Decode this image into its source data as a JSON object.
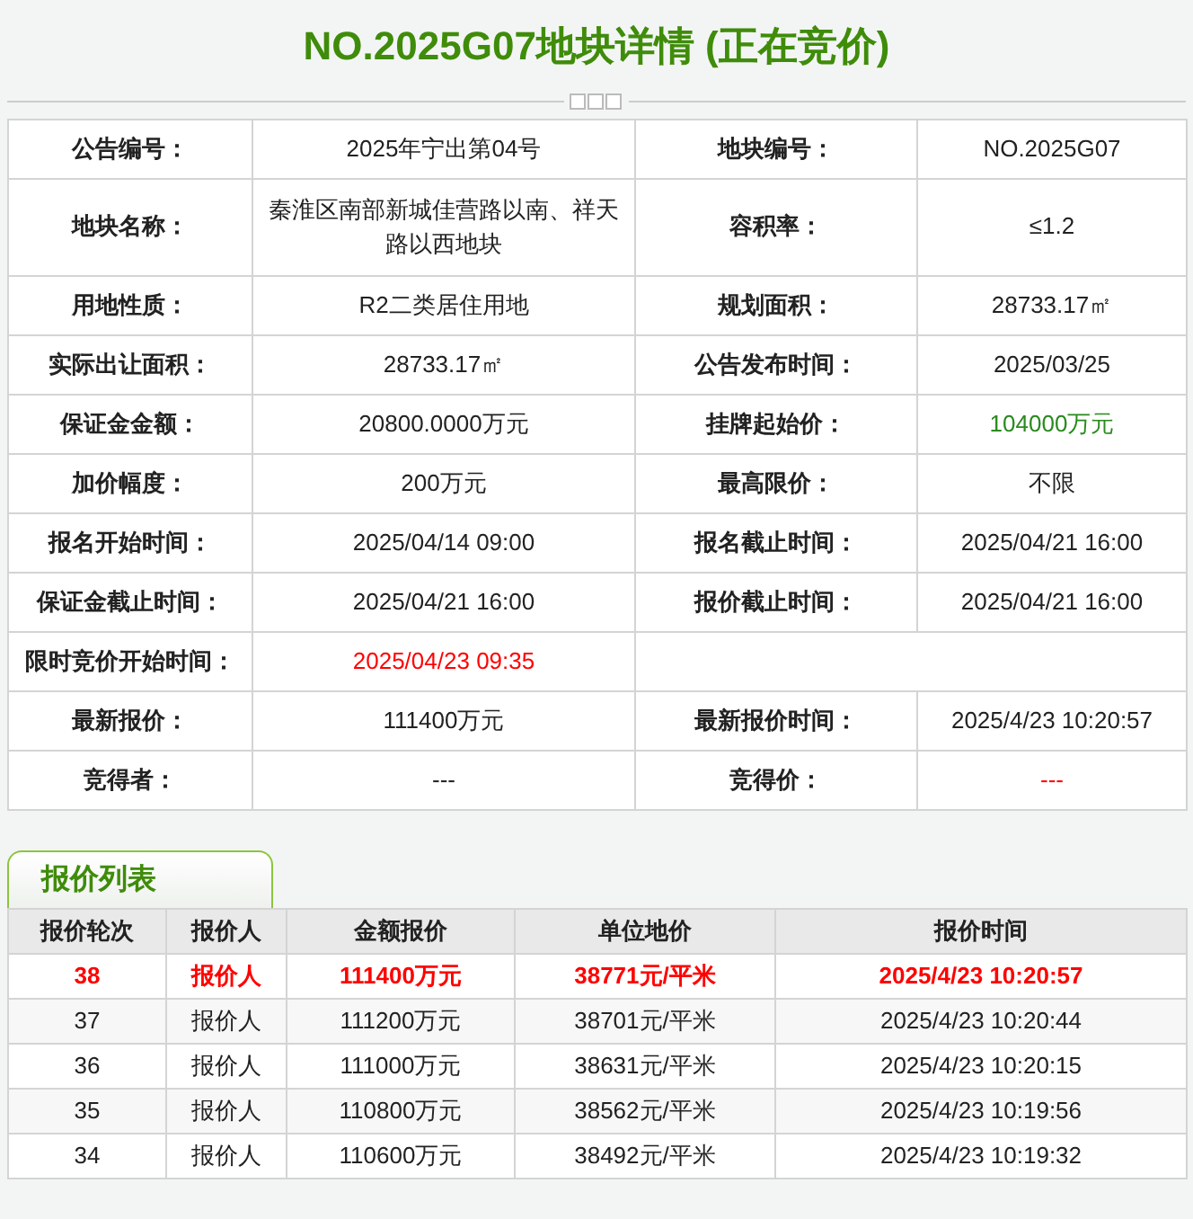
{
  "title": "NO.2025G07地块详情 (正在竞价)",
  "details": [
    {
      "cells": [
        {
          "label": "公告编号：",
          "value": "2025年宁出第04号",
          "color": "#222222"
        },
        {
          "label": "地块编号：",
          "value": "NO.2025G07",
          "color": "#222222"
        }
      ]
    },
    {
      "cells": [
        {
          "label": "地块名称：",
          "value": "秦淮区南部新城佳营路以南、祥天路以西地块",
          "color": "#222222"
        },
        {
          "label": "容积率：",
          "value": "≤1.2",
          "color": "#222222"
        }
      ]
    },
    {
      "cells": [
        {
          "label": "用地性质：",
          "value": "R2二类居住用地",
          "color": "#222222"
        },
        {
          "label": "规划面积：",
          "value": "28733.17㎡",
          "color": "#222222"
        }
      ]
    },
    {
      "cells": [
        {
          "label": "实际出让面积：",
          "value": "28733.17㎡",
          "color": "#222222"
        },
        {
          "label": "公告发布时间：",
          "value": "2025/03/25",
          "color": "#222222"
        }
      ]
    },
    {
      "cells": [
        {
          "label": "保证金金额：",
          "value": "20800.0000万元",
          "color": "#222222"
        },
        {
          "label": "挂牌起始价：",
          "value": "104000万元",
          "color": "#2a8a1e"
        }
      ]
    },
    {
      "cells": [
        {
          "label": "加价幅度：",
          "value": "200万元",
          "color": "#222222"
        },
        {
          "label": "最高限价：",
          "value": "不限",
          "color": "#222222"
        }
      ]
    },
    {
      "cells": [
        {
          "label": "报名开始时间：",
          "value": "2025/04/14 09:00",
          "color": "#222222"
        },
        {
          "label": "报名截止时间：",
          "value": "2025/04/21 16:00",
          "color": "#222222"
        }
      ]
    },
    {
      "cells": [
        {
          "label": "保证金截止时间：",
          "value": "2025/04/21 16:00",
          "color": "#222222"
        },
        {
          "label": "报价截止时间：",
          "value": "2025/04/21 16:00",
          "color": "#222222"
        }
      ]
    },
    {
      "cells": [
        {
          "label": "限时竞价开始时间：",
          "value": "2025/04/23 09:35",
          "color": "#ff0000"
        }
      ]
    },
    {
      "cells": [
        {
          "label": "最新报价：",
          "value": "111400万元",
          "color": "#222222"
        },
        {
          "label": "最新报价时间：",
          "value": "2025/4/23 10:20:57",
          "color": "#222222"
        }
      ]
    },
    {
      "cells": [
        {
          "label": "竞得者：",
          "value": "---",
          "color": "#222222"
        },
        {
          "label": "竞得价：",
          "value": "---",
          "color": "#ff0000"
        }
      ]
    }
  ],
  "bids_tab": {
    "label": "报价列表"
  },
  "bids": {
    "columns": [
      "报价轮次",
      "报价人",
      "金额报价",
      "单位地价",
      "报价时间"
    ],
    "rows": [
      {
        "cells": [
          "38",
          "报价人",
          "111400万元",
          "38771元/平米",
          "2025/4/23 10:20:57"
        ],
        "highlighted": true
      },
      {
        "cells": [
          "37",
          "报价人",
          "111200万元",
          "38701元/平米",
          "2025/4/23 10:20:44"
        ],
        "highlighted": false
      },
      {
        "cells": [
          "36",
          "报价人",
          "111000万元",
          "38631元/平米",
          "2025/4/23 10:20:15"
        ],
        "highlighted": false
      },
      {
        "cells": [
          "35",
          "报价人",
          "110800万元",
          "38562元/平米",
          "2025/4/23 10:19:56"
        ],
        "highlighted": false
      },
      {
        "cells": [
          "34",
          "报价人",
          "110600万元",
          "38492元/平米",
          "2025/4/23 10:19:32"
        ],
        "highlighted": false
      }
    ]
  }
}
